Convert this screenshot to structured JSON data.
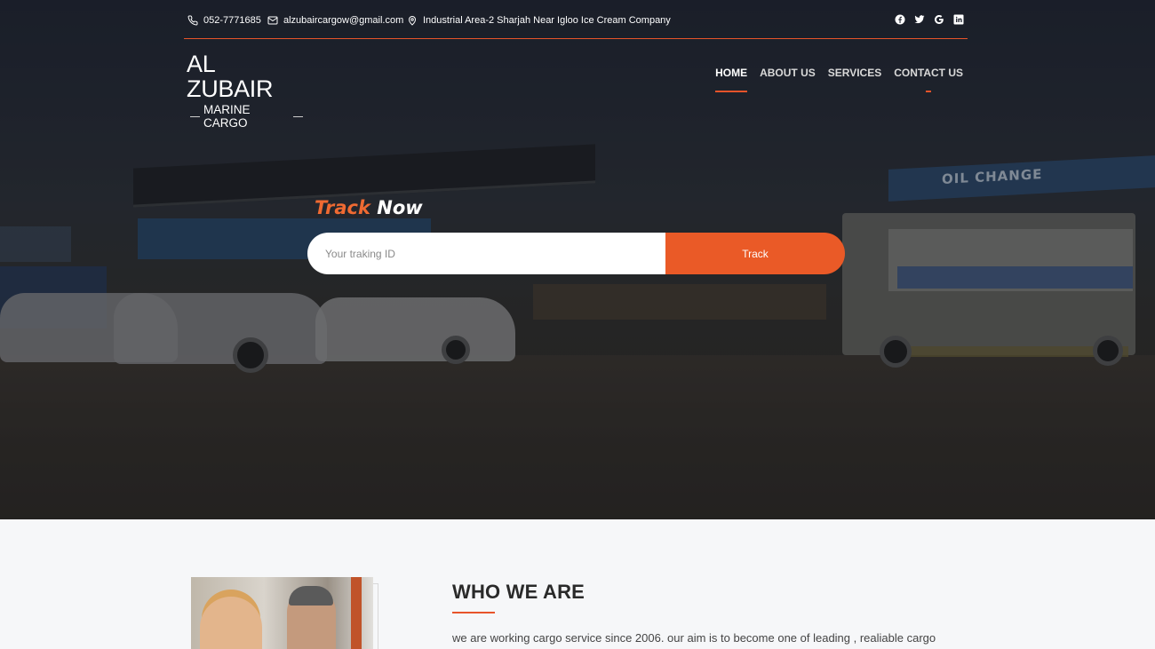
{
  "topbar": {
    "phone": "052-7771685",
    "email": "alzubaircargow@gmail.com",
    "address": "Industrial Area-2 Sharjah Near Igloo Ice Cream Company",
    "social_icons": [
      "facebook-icon",
      "twitter-icon",
      "google-icon",
      "linkedin-icon"
    ]
  },
  "logo": {
    "main": "AL ZUBAIR",
    "sub": "MARINE CARGO"
  },
  "nav": {
    "items": [
      "HOME",
      "ABOUT US",
      "SERVICES",
      "CONTACT US"
    ],
    "active": "HOME"
  },
  "hero": {
    "sign_text": "OIL CHANGE"
  },
  "track": {
    "title_part1": "Track",
    "title_part2": "Now",
    "placeholder": "Your traking ID",
    "button": "Track"
  },
  "about": {
    "title": "WHO WE ARE",
    "text": "we are working cargo service since 2006. our aim is to become one of leading , realiable cargo"
  },
  "colors": {
    "accent": "#ea5a27",
    "hero_overlay": "#1e2330",
    "section_bg": "#f6f7f9"
  }
}
